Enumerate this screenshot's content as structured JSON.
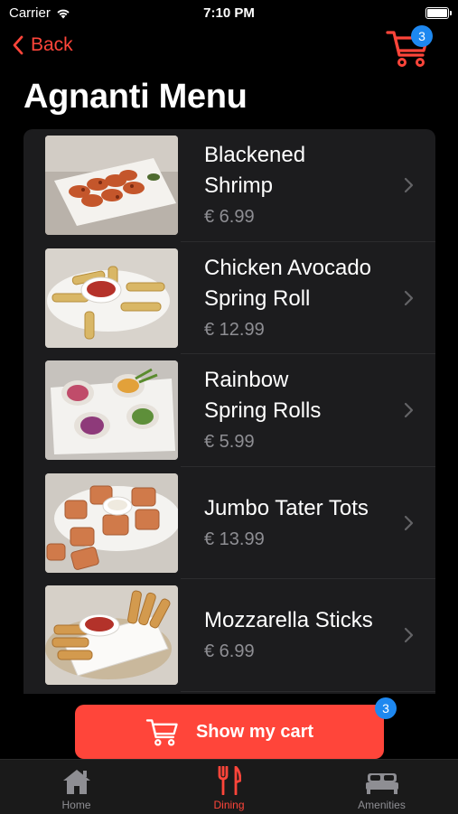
{
  "status_bar": {
    "carrier": "Carrier",
    "time": "7:10 PM"
  },
  "nav": {
    "back_label": "Back",
    "cart_count": "3"
  },
  "page_title": "Agnanti Menu",
  "menu_items": [
    {
      "name_line1": "Blackened",
      "name_line2": "Shrimp",
      "price": "€ 6.99"
    },
    {
      "name_line1": "Chicken Avocado",
      "name_line2": "Spring Roll",
      "price": "€ 12.99"
    },
    {
      "name_line1": "Rainbow",
      "name_line2": "Spring Rolls",
      "price": "€ 5.99"
    },
    {
      "name_line1": "Jumbo Tater Tots",
      "name_line2": "",
      "price": "€ 13.99"
    },
    {
      "name_line1": "Mozzarella Sticks",
      "name_line2": "",
      "price": "€ 6.99"
    }
  ],
  "cart_button": {
    "label": "Show my cart",
    "count": "3"
  },
  "tabs": [
    {
      "label": "Home",
      "icon": "home-icon"
    },
    {
      "label": "Dining",
      "icon": "fork-knife-icon",
      "active": true
    },
    {
      "label": "Amenities",
      "icon": "bed-icon"
    }
  ],
  "colors": {
    "accent": "#ff453a",
    "badge": "#1e88f0",
    "list_bg": "#1c1c1e",
    "background": "#000000"
  }
}
